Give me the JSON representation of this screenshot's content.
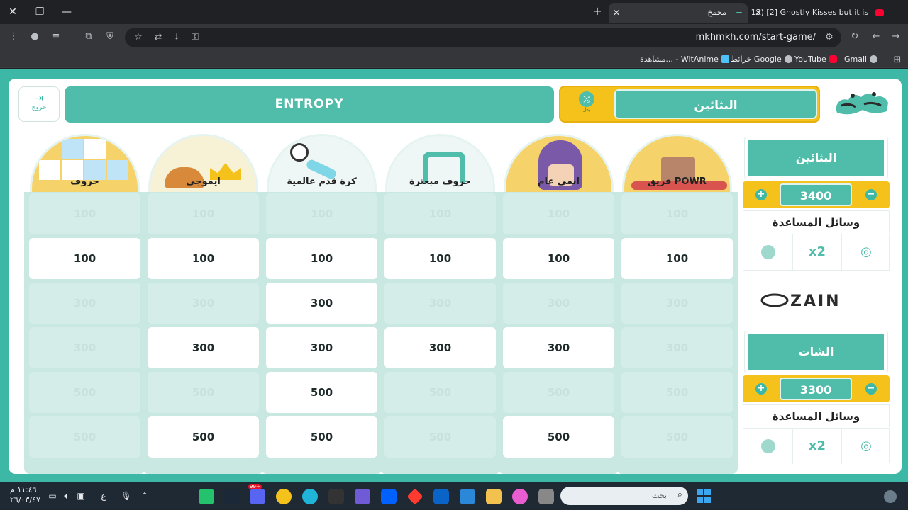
{
  "browser": {
    "tabs": [
      {
        "title": "مخمخ",
        "active": true
      },
      {
        "title": "(913) [2] Ghostly Kisses but it is",
        "active": false
      }
    ],
    "url": "mkhmkh.com/start-game/",
    "bookmarks": [
      "Gmail",
      "YouTube",
      "خرائط Google",
      "مشاهدة... - WitAnime"
    ]
  },
  "game": {
    "exit_label": "خروج",
    "current_team_banner": "ENTROPY",
    "turn_team": "البثائين",
    "swap_label": "بدل",
    "categories": [
      {
        "name": "فريق POWR",
        "color": "#f6d36a",
        "cells": [
          {
            "v": "100",
            "open": false
          },
          {
            "v": "100",
            "open": true
          },
          {
            "v": "300",
            "open": false
          },
          {
            "v": "300",
            "open": false
          },
          {
            "v": "500",
            "open": false
          },
          {
            "v": "500",
            "open": false
          }
        ]
      },
      {
        "name": "انمي عام",
        "color": "#f6d36a",
        "cells": [
          {
            "v": "100",
            "open": false
          },
          {
            "v": "100",
            "open": true
          },
          {
            "v": "300",
            "open": false
          },
          {
            "v": "300",
            "open": true
          },
          {
            "v": "500",
            "open": false
          },
          {
            "v": "500",
            "open": true
          }
        ]
      },
      {
        "name": "حروف مبعثرة",
        "color": "#eef7f5",
        "cells": [
          {
            "v": "100",
            "open": false
          },
          {
            "v": "100",
            "open": true
          },
          {
            "v": "300",
            "open": false
          },
          {
            "v": "300",
            "open": true
          },
          {
            "v": "500",
            "open": false
          },
          {
            "v": "500",
            "open": false
          }
        ]
      },
      {
        "name": "كرة قدم عالمية",
        "color": "#eef7f5",
        "cells": [
          {
            "v": "100",
            "open": false
          },
          {
            "v": "100",
            "open": true
          },
          {
            "v": "300",
            "open": true
          },
          {
            "v": "300",
            "open": true
          },
          {
            "v": "500",
            "open": true
          },
          {
            "v": "500",
            "open": true
          }
        ]
      },
      {
        "name": "ايموجي",
        "color": "#f7f1d6",
        "cells": [
          {
            "v": "100",
            "open": false
          },
          {
            "v": "100",
            "open": true
          },
          {
            "v": "300",
            "open": false
          },
          {
            "v": "300",
            "open": true
          },
          {
            "v": "500",
            "open": false
          },
          {
            "v": "500",
            "open": true
          }
        ]
      },
      {
        "name": "حروف",
        "color": "#f6d36a",
        "cells": [
          {
            "v": "100",
            "open": false
          },
          {
            "v": "100",
            "open": true
          },
          {
            "v": "300",
            "open": false
          },
          {
            "v": "300",
            "open": false
          },
          {
            "v": "500",
            "open": false
          },
          {
            "v": "500",
            "open": false
          }
        ]
      }
    ],
    "teams": [
      {
        "name": "البثائين",
        "score": "3400",
        "help_title": "وسائل المساعدة"
      },
      {
        "name": "الشات",
        "score": "3300",
        "help_title": "وسائل المساعدة"
      }
    ],
    "sponsor": "ZAIN",
    "colors": {
      "accent": "#4fbda9",
      "background": "#3db8a6",
      "highlight": "#f4c21a"
    }
  },
  "taskbar": {
    "time": "١١:٤٦ م",
    "date": "٢٦/٠٣/٤٧",
    "lang": "ع",
    "search_placeholder": "بحث",
    "notification_count": "99+"
  }
}
